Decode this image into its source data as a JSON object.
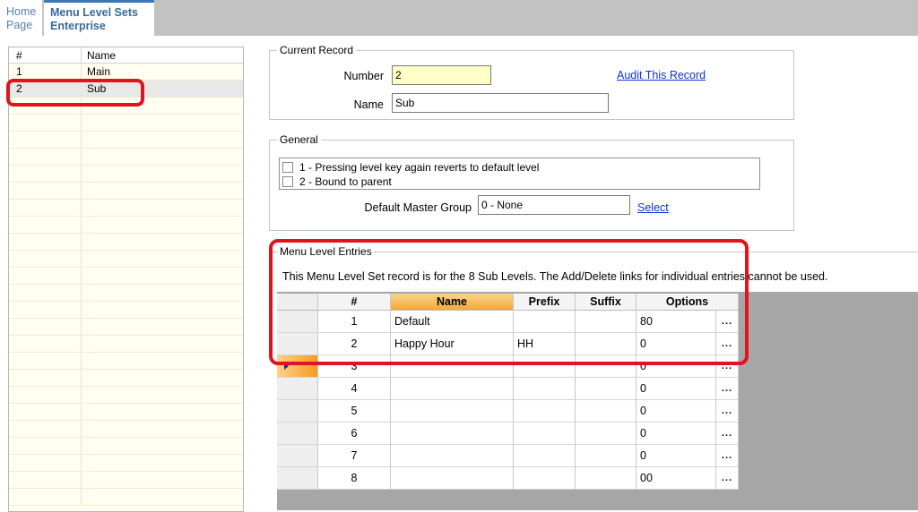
{
  "tabs": {
    "home": {
      "line1": "Home",
      "line2": "Page"
    },
    "active": {
      "line1": "Menu Level Sets",
      "line2": "Enterprise"
    }
  },
  "record_list": {
    "columns": [
      "#",
      "Name"
    ],
    "rows": [
      {
        "num": "1",
        "name": "Main"
      },
      {
        "num": "2",
        "name": "Sub"
      }
    ],
    "selected_index": 1
  },
  "current_record": {
    "title": "Current Record",
    "number_label": "Number",
    "number_value": "2",
    "name_label": "Name",
    "name_value": "Sub",
    "audit_link": "Audit This Record"
  },
  "general": {
    "title": "General",
    "options": [
      {
        "label": "1 - Pressing level key again reverts to default level",
        "checked": false
      },
      {
        "label": "2 - Bound to parent",
        "checked": false
      }
    ],
    "default_master_group_label": "Default Master Group",
    "default_master_group_value": "0 - None",
    "select_link": "Select"
  },
  "menu_level_entries": {
    "title": "Menu Level Entries",
    "description": "This Menu Level Set record is for the 8 Sub Levels. The Add/Delete links for individual entries cannot be used.",
    "columns": {
      "num": "#",
      "name": "Name",
      "prefix": "Prefix",
      "suffix": "Suffix",
      "options": "Options"
    },
    "ellipsis": "...",
    "rows": [
      {
        "num": "1",
        "name": "Default",
        "prefix": "",
        "suffix": "",
        "options": "80"
      },
      {
        "num": "2",
        "name": "Happy Hour",
        "prefix": "HH",
        "suffix": "",
        "options": "0"
      },
      {
        "num": "3",
        "name": "",
        "prefix": "",
        "suffix": "",
        "options": "0"
      },
      {
        "num": "4",
        "name": "",
        "prefix": "",
        "suffix": "",
        "options": "0"
      },
      {
        "num": "5",
        "name": "",
        "prefix": "",
        "suffix": "",
        "options": "0"
      },
      {
        "num": "6",
        "name": "",
        "prefix": "",
        "suffix": "",
        "options": "0"
      },
      {
        "num": "7",
        "name": "",
        "prefix": "",
        "suffix": "",
        "options": "0"
      },
      {
        "num": "8",
        "name": "",
        "prefix": "",
        "suffix": "",
        "options": "00"
      }
    ],
    "active_row_index": 2
  },
  "colors": {
    "annotation": "#e0141e",
    "link": "#0a35d6",
    "header_highlight": "#f4a93a",
    "tab_accent": "#3a78b7"
  }
}
